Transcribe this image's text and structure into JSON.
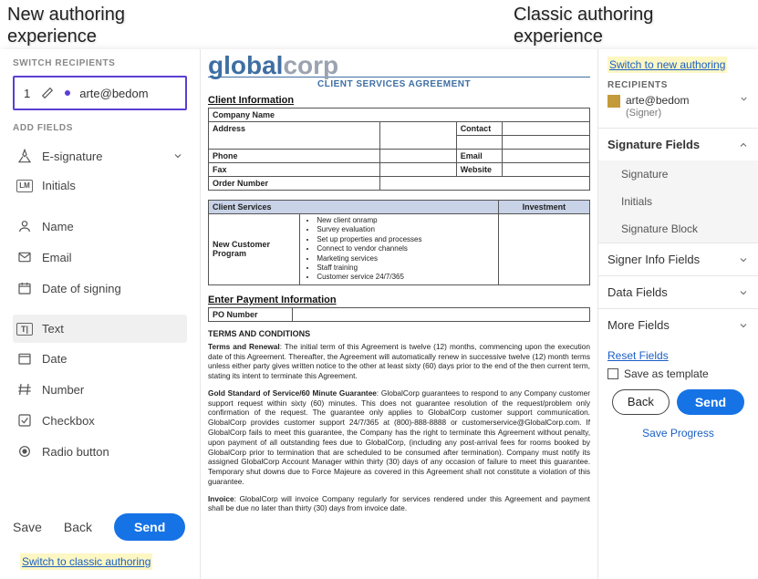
{
  "labels": {
    "new_experience": "New authoring experience",
    "classic_experience": "Classic authoring experience"
  },
  "left": {
    "switch_recipients": "SWITCH RECIPIENTS",
    "recipient_num": "1",
    "recipient_email": "arte@bedom",
    "add_fields": "ADD FIELDS",
    "esignature": "E-signature",
    "initials": "Initials",
    "name": "Name",
    "email": "Email",
    "date_of_signing": "Date of signing",
    "text": "Text",
    "date": "Date",
    "number": "Number",
    "checkbox": "Checkbox",
    "radio": "Radio button",
    "save": "Save",
    "back": "Back",
    "send": "Send",
    "switch_classic": "Switch to classic authoring"
  },
  "doc": {
    "logo_global": "global",
    "logo_corp": "corp",
    "agreement_title": "CLIENT SERVICES AGREEMENT",
    "client_info": "Client Information",
    "company_name": "Company Name",
    "address": "Address",
    "contact": "Contact",
    "phone": "Phone",
    "email": "Email",
    "fax": "Fax",
    "website": "Website",
    "order_number": "Order Number",
    "client_services": "Client Services",
    "investment": "Investment",
    "new_customer_program": "New Customer Program",
    "b1": "New client onramp",
    "b2": "Survey evaluation",
    "b3": "Set up properties and processes",
    "b4": "Connect to vendor channels",
    "b5": "Marketing services",
    "b6": "Staff training",
    "b7": "Customer service 24/7/365",
    "enter_payment": "Enter Payment Information",
    "po_number": "PO Number",
    "terms_heading": "TERMS AND CONDITIONS",
    "p1": "Terms and Renewal: The initial term of this Agreement is twelve (12) months, commencing upon the execution date of this Agreement. Thereafter, the Agreement will automatically renew in successive twelve (12) month terms unless either party gives written notice to the other at least sixty (60) days prior to the end of the then current term, stating its intent to terminate this Agreement.",
    "p2": "Gold Standard of Service/60 Minute Guarantee: GlobalCorp guarantees to respond to any Company customer support request within sixty (60) minutes. This does not guarantee resolution of the request/problem only confirmation of the request. The guarantee only applies to GlobalCorp customer support communication. GlobalCorp provides customer support 24/7/365 at (800)-888-8888 or customerservice@GlobalCorp.com. If GlobalCorp fails to meet this guarantee, the Company has the right to terminate this Agreement without penalty, upon payment of all outstanding fees due to GlobalCorp, (including any post-arrival fees for rooms booked by GlobalCorp prior to termination that are scheduled to be consumed after termination). Company must notify its assigned GlobalCorp Account Manager within thirty (30) days of any occasion of failure to meet this guarantee. Temporary shut downs due to Force Majeure as covered in this Agreement shall not constitute a violation of this guarantee.",
    "p3": "Invoice: GlobalCorp will invoice Company regularly for services rendered under this Agreement and payment shall be due no later than thirty (30) days from invoice date."
  },
  "right": {
    "switch_new": "Switch to new authoring",
    "recipients": "RECIPIENTS",
    "recipient_email": "arte@bedom",
    "signer": "(Signer)",
    "signature_fields": "Signature Fields",
    "signature": "Signature",
    "initials": "Initials",
    "signature_block": "Signature Block",
    "signer_info": "Signer Info Fields",
    "data_fields": "Data Fields",
    "more_fields": "More Fields",
    "reset_fields": "Reset Fields",
    "save_as_template": "Save as template",
    "back": "Back",
    "send": "Send",
    "save_progress": "Save Progress"
  }
}
